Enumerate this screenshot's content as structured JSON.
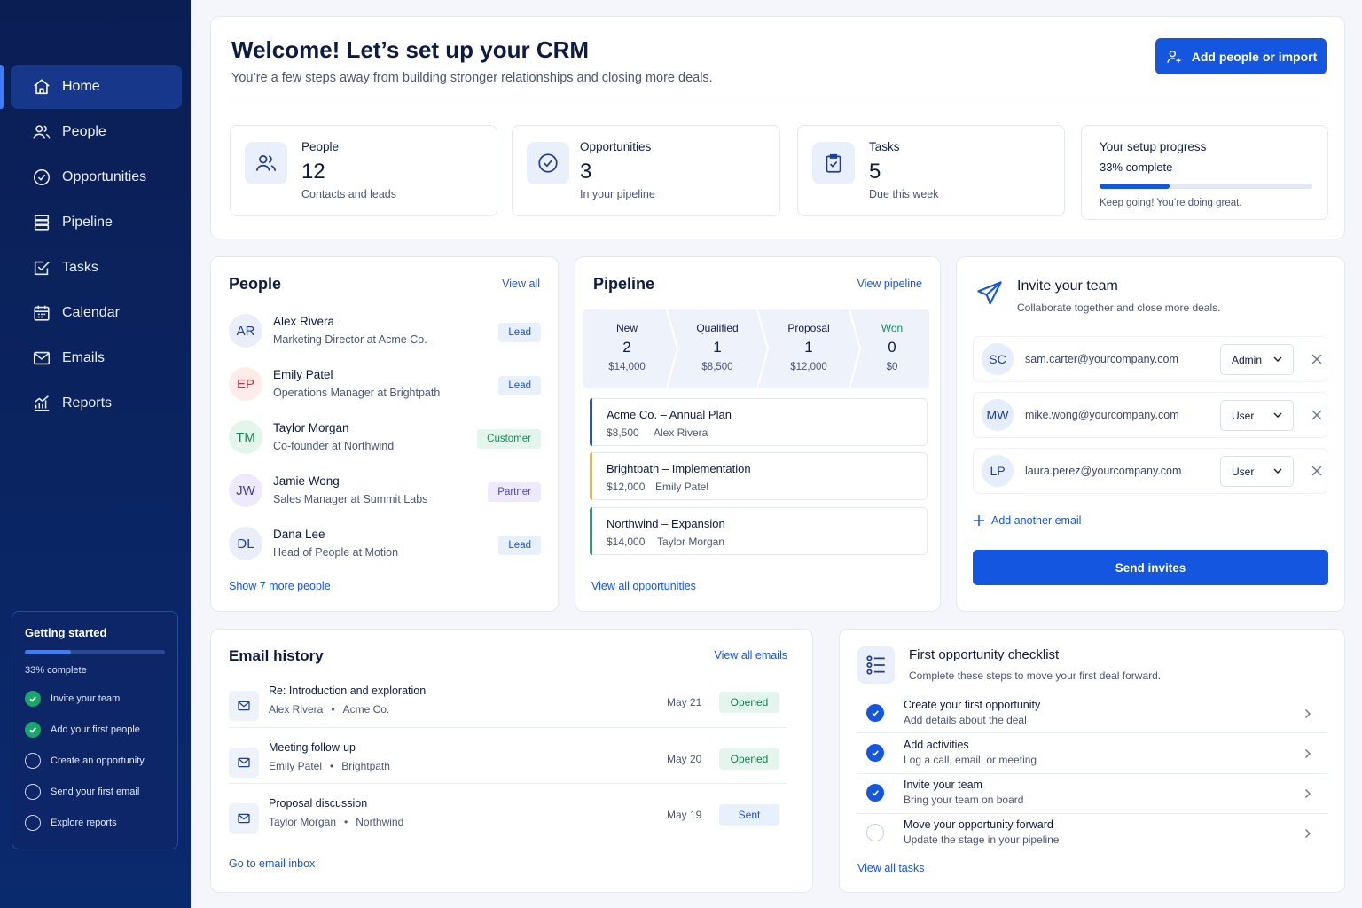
{
  "colors": {
    "sidebar_bg": "#0b1e54",
    "sidebar_active": "#17378a",
    "primary": "#1556e0",
    "success": "#1aa56b",
    "warning": "#f1b431"
  },
  "sidebar": {
    "items": [
      {
        "label": "Home",
        "icon": "home-icon"
      },
      {
        "label": "People",
        "icon": "people-icon"
      },
      {
        "label": "Opportunities",
        "icon": "opportunities-icon"
      },
      {
        "label": "Pipeline",
        "icon": "pipeline-icon"
      },
      {
        "label": "Tasks",
        "icon": "tasks-icon"
      },
      {
        "label": "Calendar",
        "icon": "calendar-icon"
      },
      {
        "label": "Emails",
        "icon": "mail-icon"
      },
      {
        "label": "Reports",
        "icon": "reports-icon"
      }
    ],
    "getting_started": {
      "title": "Getting started",
      "progress": 0.33,
      "progress_label": "33% complete",
      "items": [
        {
          "label": "Invite your team",
          "done": true
        },
        {
          "label": "Add your first people",
          "done": true
        },
        {
          "label": "Create an opportunity",
          "done": false
        },
        {
          "label": "Send your first email",
          "done": false
        },
        {
          "label": "Explore reports",
          "done": false
        }
      ]
    }
  },
  "header": {
    "title": "Welcome! Let’s set up your CRM",
    "subtitle": "You’re a few steps away from building stronger relationships and closing more deals.",
    "primary_button": "Add people or import"
  },
  "stats": [
    {
      "label": "People",
      "value": "12",
      "sub": "Contacts and leads",
      "icon": "people-icon"
    },
    {
      "label": "Opportunities",
      "value": "3",
      "sub": "In your pipeline",
      "icon": "check-circle-icon"
    },
    {
      "label": "Tasks",
      "value": "5",
      "sub": "Due this week",
      "icon": "clipboard-check-icon"
    }
  ],
  "setup": {
    "title": "Your setup progress",
    "percent_label": "33% complete",
    "progress": 0.33,
    "message": "Keep going! You’re doing great."
  },
  "people": {
    "title": "People",
    "view_all": "View all",
    "items": [
      {
        "initials": "AR",
        "name": "Alex Rivera",
        "role": "Marketing Director at Acme Co.",
        "badge": "Lead"
      },
      {
        "initials": "EP",
        "name": "Emily Patel",
        "role": "Operations Manager at Brightpath",
        "badge": "Lead"
      },
      {
        "initials": "TM",
        "name": "Taylor Morgan",
        "role": "Co-founder at Northwind",
        "badge": "Customer"
      },
      {
        "initials": "JW",
        "name": "Jamie Wong",
        "role": "Sales Manager at Summit Labs",
        "badge": "Partner"
      },
      {
        "initials": "DL",
        "name": "Dana Lee",
        "role": "Head of People at Motion",
        "badge": "Lead"
      }
    ],
    "show_more": "Show 7 more people"
  },
  "pipeline": {
    "title": "Pipeline",
    "view_link": "View pipeline",
    "stages": [
      {
        "name": "New",
        "count": "2",
        "amount": "$14,000"
      },
      {
        "name": "Qualified",
        "count": "1",
        "amount": "$8,500"
      },
      {
        "name": "Proposal",
        "count": "1",
        "amount": "$12,000"
      },
      {
        "name": "Won",
        "count": "0",
        "amount": "$0"
      }
    ],
    "opportunities": [
      {
        "title": "Acme Co. – Annual Plan",
        "amount": "$8,500",
        "owner": "Alex Rivera"
      },
      {
        "title": "Brightpath – Implementation",
        "amount": "$12,000",
        "owner": "Emily Patel"
      },
      {
        "title": "Northwind – Expansion",
        "amount": "$14,000",
        "owner": "Taylor Morgan"
      }
    ],
    "view_all": "View all opportunities"
  },
  "invite": {
    "title": "Invite your team",
    "subtitle": "Collaborate together and close more deals.",
    "rows": [
      {
        "initials": "SC",
        "email": "sam.carter@yourcompany.com",
        "role": "Admin"
      },
      {
        "initials": "MW",
        "email": "mike.wong@yourcompany.com",
        "role": "User"
      },
      {
        "initials": "LP",
        "email": "laura.perez@yourcompany.com",
        "role": "User"
      }
    ],
    "add_another": "Add another email",
    "send_button": "Send invites"
  },
  "emails": {
    "title": "Email history",
    "view_all": "View all emails",
    "items": [
      {
        "subject": "Re: Introduction and exploration",
        "person": "Alex Rivera",
        "company": "Acme Co.",
        "date": "May 21",
        "status": "Opened"
      },
      {
        "subject": "Meeting follow-up",
        "person": "Emily Patel",
        "company": "Brightpath",
        "date": "May 20",
        "status": "Opened"
      },
      {
        "subject": "Proposal discussion",
        "person": "Taylor Morgan",
        "company": "Northwind",
        "date": "May 19",
        "status": "Sent"
      }
    ],
    "inbox_link": "Go to email inbox"
  },
  "checklist": {
    "title": "First opportunity checklist",
    "subtitle": "Complete these steps to move your first deal forward.",
    "items": [
      {
        "title": "Create your first opportunity",
        "sub": "Add details about the deal",
        "done": true
      },
      {
        "title": "Add activities",
        "sub": "Log a call, email, or meeting",
        "done": true
      },
      {
        "title": "Invite your team",
        "sub": "Bring your team on board",
        "done": true
      },
      {
        "title": "Move your opportunity forward",
        "sub": "Update the stage in your pipeline",
        "done": false
      }
    ],
    "view_all": "View all tasks"
  }
}
